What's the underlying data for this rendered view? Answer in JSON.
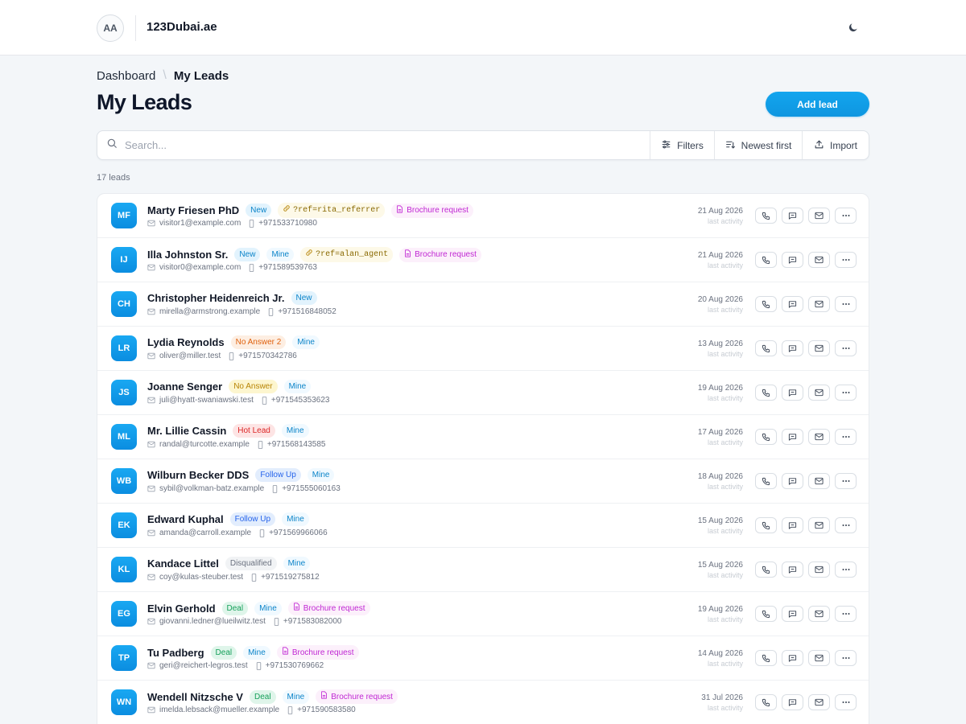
{
  "header": {
    "avatar_initials": "AA",
    "brand": "123Dubai.ae",
    "theme_icon": "moon-icon"
  },
  "breadcrumb": {
    "parent": "Dashboard",
    "separator": "\\",
    "current": "My Leads"
  },
  "page": {
    "title": "My Leads",
    "add_button": "Add lead"
  },
  "toolbar": {
    "search_placeholder": "Search...",
    "filters_label": "Filters",
    "sort_label": "Newest first",
    "import_label": "Import"
  },
  "lead_count": "17 leads",
  "last_activity_label": "last activity",
  "colors": {
    "accent": "#0ea5e9",
    "avatar": "#0b8de0"
  },
  "leads": [
    {
      "initials": "MF",
      "name": "Marty Friesen PhD",
      "badges": [
        {
          "text": "New",
          "kind": "new"
        },
        {
          "text": "?ref=rita_referrer",
          "kind": "ref"
        },
        {
          "text": "Brochure request",
          "kind": "brochure"
        }
      ],
      "email": "visitor1@example.com",
      "phone": "+971533710980",
      "date": "21 Aug 2026"
    },
    {
      "initials": "IJ",
      "name": "Illa Johnston Sr.",
      "badges": [
        {
          "text": "New",
          "kind": "new"
        },
        {
          "text": "Mine",
          "kind": "mine"
        },
        {
          "text": "?ref=alan_agent",
          "kind": "ref"
        },
        {
          "text": "Brochure request",
          "kind": "brochure"
        }
      ],
      "email": "visitor0@example.com",
      "phone": "+971589539763",
      "date": "21 Aug 2026"
    },
    {
      "initials": "CH",
      "name": "Christopher Heidenreich Jr.",
      "badges": [
        {
          "text": "New",
          "kind": "new"
        }
      ],
      "email": "mirella@armstrong.example",
      "phone": "+971516848052",
      "date": "20 Aug 2026"
    },
    {
      "initials": "LR",
      "name": "Lydia Reynolds",
      "badges": [
        {
          "text": "No Answer 2",
          "kind": "noanswer2"
        },
        {
          "text": "Mine",
          "kind": "mine"
        }
      ],
      "email": "oliver@miller.test",
      "phone": "+971570342786",
      "date": "13 Aug 2026"
    },
    {
      "initials": "JS",
      "name": "Joanne Senger",
      "badges": [
        {
          "text": "No Answer",
          "kind": "noanswer"
        },
        {
          "text": "Mine",
          "kind": "mine"
        }
      ],
      "email": "juli@hyatt-swaniawski.test",
      "phone": "+971545353623",
      "date": "19 Aug 2026"
    },
    {
      "initials": "ML",
      "name": "Mr. Lillie Cassin",
      "badges": [
        {
          "text": "Hot Lead",
          "kind": "hot"
        },
        {
          "text": "Mine",
          "kind": "mine"
        }
      ],
      "email": "randal@turcotte.example",
      "phone": "+971568143585",
      "date": "17 Aug 2026"
    },
    {
      "initials": "WB",
      "name": "Wilburn Becker DDS",
      "badges": [
        {
          "text": "Follow Up",
          "kind": "follow"
        },
        {
          "text": "Mine",
          "kind": "mine"
        }
      ],
      "email": "sybil@volkman-batz.example",
      "phone": "+971555060163",
      "date": "18 Aug 2026"
    },
    {
      "initials": "EK",
      "name": "Edward Kuphal",
      "badges": [
        {
          "text": "Follow Up",
          "kind": "follow"
        },
        {
          "text": "Mine",
          "kind": "mine"
        }
      ],
      "email": "amanda@carroll.example",
      "phone": "+971569966066",
      "date": "15 Aug 2026"
    },
    {
      "initials": "KL",
      "name": "Kandace Littel",
      "badges": [
        {
          "text": "Disqualified",
          "kind": "disq"
        },
        {
          "text": "Mine",
          "kind": "mine"
        }
      ],
      "email": "coy@kulas-steuber.test",
      "phone": "+971519275812",
      "date": "15 Aug 2026"
    },
    {
      "initials": "EG",
      "name": "Elvin Gerhold",
      "badges": [
        {
          "text": "Deal",
          "kind": "deal"
        },
        {
          "text": "Mine",
          "kind": "mine"
        },
        {
          "text": "Brochure request",
          "kind": "brochure"
        }
      ],
      "email": "giovanni.ledner@lueilwitz.test",
      "phone": "+971583082000",
      "date": "19 Aug 2026"
    },
    {
      "initials": "TP",
      "name": "Tu Padberg",
      "badges": [
        {
          "text": "Deal",
          "kind": "deal"
        },
        {
          "text": "Mine",
          "kind": "mine"
        },
        {
          "text": "Brochure request",
          "kind": "brochure"
        }
      ],
      "email": "geri@reichert-legros.test",
      "phone": "+971530769662",
      "date": "14 Aug 2026"
    },
    {
      "initials": "WN",
      "name": "Wendell Nitzsche V",
      "badges": [
        {
          "text": "Deal",
          "kind": "deal"
        },
        {
          "text": "Mine",
          "kind": "mine"
        },
        {
          "text": "Brochure request",
          "kind": "brochure"
        }
      ],
      "email": "imelda.lebsack@mueller.example",
      "phone": "+971590583580",
      "date": "31 Jul 2026"
    }
  ]
}
